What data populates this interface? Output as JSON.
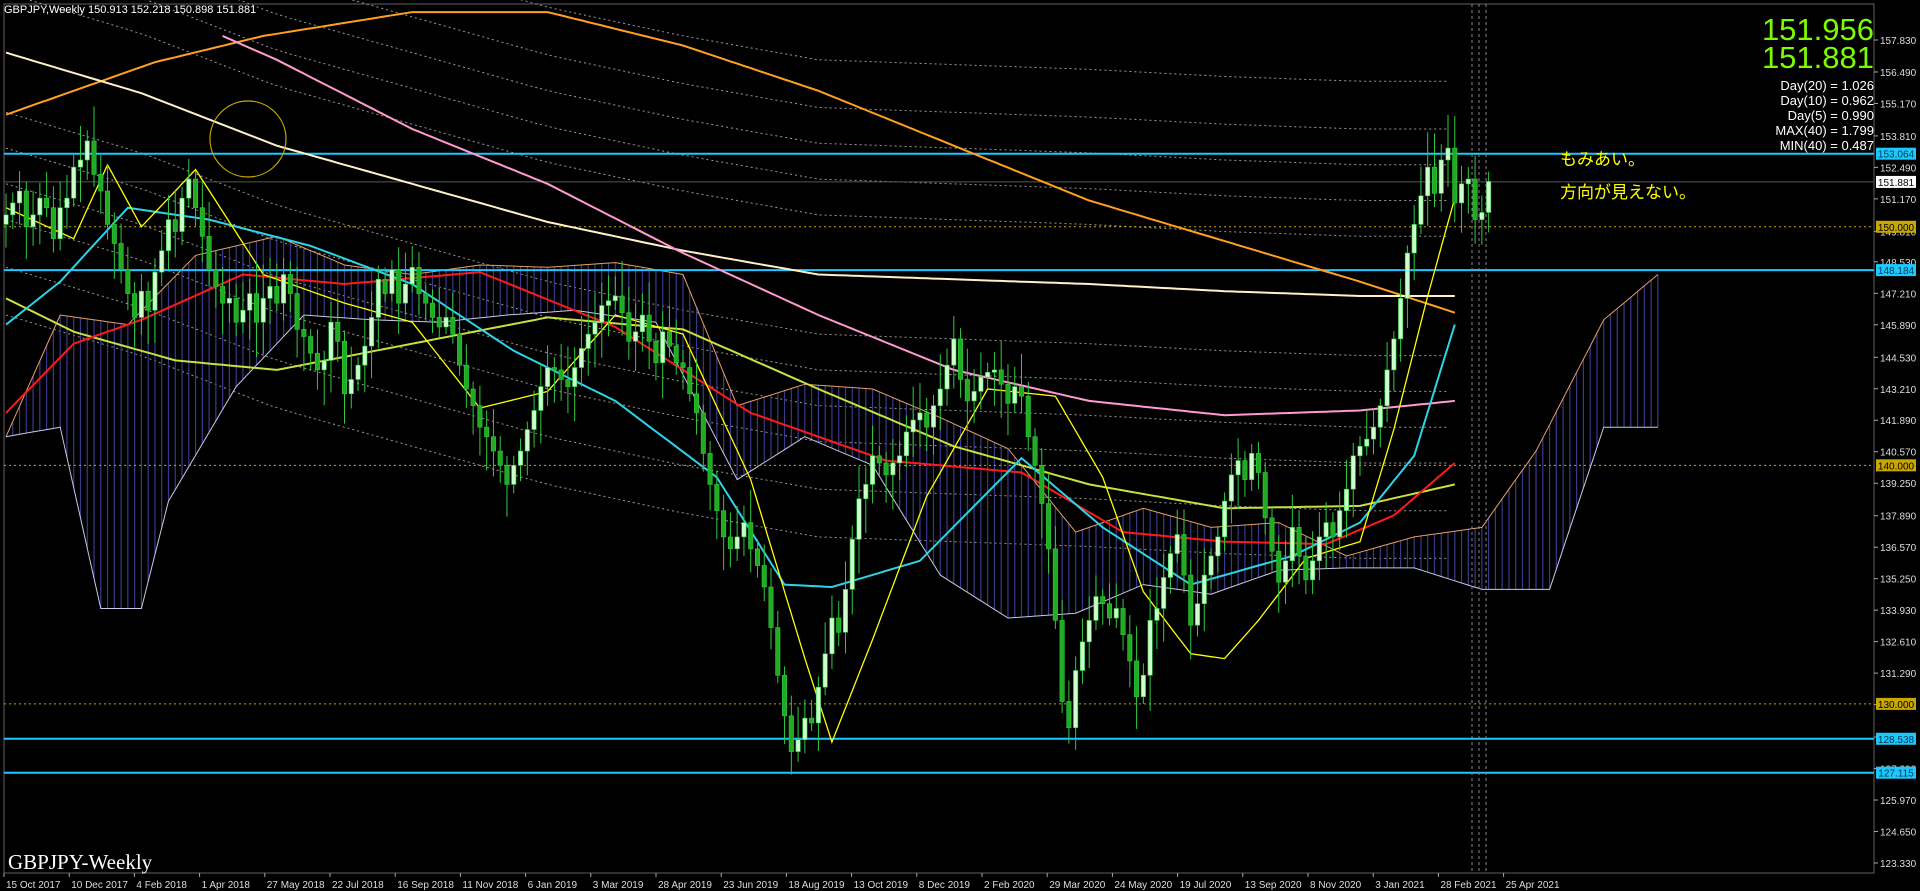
{
  "header": {
    "symbol": "GBPJPY,Weekly",
    "ohlc": "150.913 152.218 150.898 151.881"
  },
  "watermark": "GBPJPY-Weekly",
  "panel": {
    "bid": "151.956",
    "ask": "151.881",
    "stats": [
      "Day(20) = 1.026",
      "Day(10) = 0.962",
      "Day(5) = 0.990",
      "MAX(40) = 1.799",
      "MIN(40) = 0.487"
    ]
  },
  "annotations": [
    "もみあい。",
    "方向が見えない。"
  ],
  "colors": {
    "background": "#000000",
    "bull": "#CCFFCC",
    "bear": "#22AA22",
    "hline": "#1CC8FF",
    "price_label": "#FFFFFF",
    "level_label": "#C8A800",
    "ma_yellow": "#FFFF00",
    "ma_cyan": "#2BD4E8",
    "ma_red": "#FF1A1A",
    "ma_olive": "#C8E040",
    "ma_pink": "#FF9AD0",
    "ma_wheat": "#FFF0C8",
    "ma_orange": "#FFA020"
  },
  "chart_data": {
    "type": "candlestick",
    "ylim": [
      123.33,
      158.03
    ],
    "y_ticks": [
      "157.830",
      "156.490",
      "155.170",
      "153.810",
      "152.490",
      "151.170",
      "149.810",
      "148.530",
      "147.210",
      "145.890",
      "144.530",
      "143.210",
      "141.890",
      "140.570",
      "139.250",
      "137.890",
      "136.570",
      "135.250",
      "133.930",
      "132.610",
      "131.290",
      "129.970",
      "128.610",
      "127.290",
      "125.970",
      "124.650",
      "123.330"
    ],
    "x_labels": [
      "15 Oct 2017",
      "10 Dec 2017",
      "4 Feb 2018",
      "1 Apr 2018",
      "27 May 2018",
      "22 Jul 2018",
      "16 Sep 2018",
      "11 Nov 2018",
      "6 Jan 2019",
      "3 Mar 2019",
      "28 Apr 2019",
      "23 Jun 2019",
      "18 Aug 2019",
      "13 Oct 2019",
      "8 Dec 2019",
      "2 Feb 2020",
      "29 Mar 2020",
      "24 May 2020",
      "19 Jul 2020",
      "13 Sep 2020",
      "8 Nov 2020",
      "3 Jan 2021",
      "28 Feb 2021",
      "25 Apr 2021"
    ],
    "hlines": [
      {
        "value": 153.064,
        "label": "153.064",
        "style": "solid-cyan"
      },
      {
        "value": 148.184,
        "label": "148.184",
        "style": "solid-cyan"
      },
      {
        "value": 128.538,
        "label": "128.538",
        "style": "solid-cyan"
      },
      {
        "value": 127.115,
        "label": "127.115",
        "style": "solid-cyan"
      },
      {
        "value": 150.0,
        "label": "150.000",
        "style": "dotted-gold"
      },
      {
        "value": 140.0,
        "label": "140.000",
        "style": "dotted-gold"
      },
      {
        "value": 130.0,
        "label": "130.000",
        "style": "dotted-gold"
      }
    ],
    "current_price": {
      "value": 151.881,
      "label": "151.881"
    },
    "closes": [
      150.5,
      151.0,
      151.5,
      150.0,
      150.5,
      151.2,
      150.8,
      149.5,
      150.8,
      151.2,
      152.5,
      152.8,
      153.6,
      152.2,
      151.5,
      150.1,
      149.3,
      148.2,
      147.2,
      146.2,
      147.3,
      146.5,
      148.1,
      149.0,
      150.3,
      149.8,
      151.2,
      152.0,
      150.8,
      149.6,
      148.2,
      147.5,
      146.8,
      147.0,
      146.0,
      146.5,
      147.2,
      146.0,
      147.0,
      147.5,
      146.8,
      148.0,
      147.2,
      145.7,
      145.4,
      144.7,
      144.0,
      144.4,
      146.0,
      145.2,
      143.0,
      143.6,
      144.2,
      145.0,
      146.2,
      147.8,
      147.2,
      148.2,
      146.8,
      147.6,
      148.3,
      147.2,
      146.8,
      146.2,
      145.8,
      146.2,
      145.5,
      144.2,
      143.2,
      142.5,
      141.6,
      141.2,
      140.6,
      140.0,
      139.2,
      140.0,
      140.6,
      141.5,
      142.3,
      143.3,
      144.1,
      144.0,
      143.6,
      143.3,
      144.1,
      144.9,
      145.5,
      146.0,
      146.7,
      146.9,
      147.1,
      146.4,
      145.2,
      145.6,
      146.3,
      145.2,
      144.3,
      145.6,
      145.0,
      144.3,
      144.1,
      143.0,
      142.2,
      140.5,
      139.2,
      138.1,
      137.0,
      136.5,
      137.0,
      137.6,
      136.5,
      135.8,
      134.9,
      133.2,
      131.2,
      129.5,
      128.0,
      128.5,
      129.4,
      129.2,
      130.7,
      132.1,
      133.6,
      133.0,
      134.8,
      136.9,
      138.6,
      139.2,
      140.4,
      140.1,
      139.6,
      140.1,
      140.4,
      141.4,
      141.9,
      142.2,
      141.6,
      142.5,
      143.2,
      144.2,
      145.3,
      143.6,
      142.7,
      143.1,
      143.7,
      143.9,
      144.0,
      143.4,
      142.6,
      143.3,
      142.9,
      141.2,
      140.0,
      138.4,
      136.5,
      133.5,
      130.1,
      129.0,
      131.4,
      132.6,
      133.5,
      134.5,
      134.2,
      133.6,
      134.0,
      132.9,
      131.8,
      130.3,
      131.2,
      133.5,
      134.0,
      135.3,
      136.3,
      137.1,
      135.4,
      133.3,
      134.2,
      135.4,
      136.2,
      137.0,
      138.5,
      139.6,
      140.2,
      139.4,
      140.5,
      139.7,
      137.8,
      136.4,
      135.1,
      136.0,
      137.4,
      136.2,
      135.2,
      136.0,
      137.0,
      137.6,
      137.0,
      138.1,
      139.0,
      140.4,
      140.8,
      141.1,
      141.6,
      142.5,
      144.0,
      145.3,
      147.0,
      148.9,
      150.1,
      151.3,
      152.5,
      151.4,
      152.8,
      153.3,
      151.0,
      151.8,
      152.0,
      150.3,
      150.6,
      151.9
    ],
    "moving_averages": [
      {
        "key": "ma_orange",
        "values": [
          [
            0,
            154.7
          ],
          [
            10,
            155.7
          ],
          [
            22,
            156.9
          ],
          [
            38,
            158.0
          ],
          [
            60,
            159.0
          ],
          [
            80,
            159.0
          ],
          [
            100,
            157.6
          ],
          [
            120,
            155.7
          ],
          [
            140,
            153.4
          ],
          [
            160,
            151.1
          ],
          [
            180,
            149.4
          ],
          [
            200,
            147.7
          ],
          [
            214,
            146.4
          ]
        ]
      },
      {
        "key": "ma_wheat",
        "values": [
          [
            0,
            157.3
          ],
          [
            20,
            155.6
          ],
          [
            40,
            153.4
          ],
          [
            60,
            151.8
          ],
          [
            80,
            150.2
          ],
          [
            100,
            149.0
          ],
          [
            120,
            148.0
          ],
          [
            140,
            147.8
          ],
          [
            160,
            147.6
          ],
          [
            180,
            147.3
          ],
          [
            200,
            147.1
          ],
          [
            214,
            147.1
          ]
        ]
      },
      {
        "key": "ma_pink",
        "values": [
          [
            32,
            158.0
          ],
          [
            40,
            157.0
          ],
          [
            60,
            154.1
          ],
          [
            80,
            151.8
          ],
          [
            100,
            148.9
          ],
          [
            120,
            146.3
          ],
          [
            140,
            144.0
          ],
          [
            160,
            142.7
          ],
          [
            180,
            142.1
          ],
          [
            200,
            142.3
          ],
          [
            214,
            142.7
          ]
        ]
      },
      {
        "key": "ma_olive",
        "values": [
          [
            0,
            147.0
          ],
          [
            10,
            145.6
          ],
          [
            25,
            144.4
          ],
          [
            40,
            144.0
          ],
          [
            60,
            145.1
          ],
          [
            80,
            146.2
          ],
          [
            100,
            145.7
          ],
          [
            120,
            143.2
          ],
          [
            140,
            140.8
          ],
          [
            160,
            139.2
          ],
          [
            180,
            138.2
          ],
          [
            200,
            138.3
          ],
          [
            214,
            139.2
          ]
        ]
      },
      {
        "key": "ma_red",
        "values": [
          [
            0,
            142.2
          ],
          [
            10,
            145.1
          ],
          [
            20,
            146.1
          ],
          [
            35,
            148.0
          ],
          [
            50,
            147.6
          ],
          [
            70,
            148.1
          ],
          [
            90,
            145.8
          ],
          [
            110,
            142.2
          ],
          [
            130,
            140.2
          ],
          [
            150,
            139.7
          ],
          [
            165,
            137.2
          ],
          [
            180,
            136.8
          ],
          [
            195,
            136.7
          ],
          [
            205,
            137.9
          ],
          [
            214,
            140.1
          ]
        ]
      },
      {
        "key": "ma_cyan",
        "values": [
          [
            0,
            145.9
          ],
          [
            8,
            147.7
          ],
          [
            18,
            150.8
          ],
          [
            30,
            150.3
          ],
          [
            45,
            149.2
          ],
          [
            60,
            147.6
          ],
          [
            75,
            144.8
          ],
          [
            90,
            142.7
          ],
          [
            105,
            139.5
          ],
          [
            115,
            135.0
          ],
          [
            122,
            134.9
          ],
          [
            135,
            136.0
          ],
          [
            150,
            140.3
          ],
          [
            162,
            137.4
          ],
          [
            175,
            135.0
          ],
          [
            190,
            136.2
          ],
          [
            200,
            137.6
          ],
          [
            208,
            140.4
          ],
          [
            214,
            145.9
          ]
        ]
      },
      {
        "key": "ma_yellow",
        "values": [
          [
            0,
            150.8
          ],
          [
            10,
            149.5
          ],
          [
            15,
            152.6
          ],
          [
            20,
            150.0
          ],
          [
            28,
            152.4
          ],
          [
            38,
            148.0
          ],
          [
            50,
            146.8
          ],
          [
            60,
            146.0
          ],
          [
            70,
            142.4
          ],
          [
            80,
            143.1
          ],
          [
            90,
            146.3
          ],
          [
            100,
            145.5
          ],
          [
            110,
            139.4
          ],
          [
            118,
            131.9
          ],
          [
            122,
            128.4
          ],
          [
            128,
            132.7
          ],
          [
            136,
            138.7
          ],
          [
            145,
            143.2
          ],
          [
            155,
            142.9
          ],
          [
            162,
            139.5
          ],
          [
            168,
            134.7
          ],
          [
            175,
            132.1
          ],
          [
            180,
            131.9
          ],
          [
            185,
            133.5
          ],
          [
            192,
            136.1
          ],
          [
            200,
            136.8
          ],
          [
            205,
            141.5
          ],
          [
            210,
            147.1
          ],
          [
            214,
            151.2
          ]
        ]
      }
    ],
    "ichimoku_cloud": {
      "upper": [
        [
          0,
          141.2
        ],
        [
          8,
          146.3
        ],
        [
          18,
          145.9
        ],
        [
          28,
          148.8
        ],
        [
          40,
          149.6
        ],
        [
          50,
          148.4
        ],
        [
          60,
          148.0
        ],
        [
          70,
          148.4
        ],
        [
          80,
          148.3
        ],
        [
          90,
          148.5
        ],
        [
          100,
          148.0
        ],
        [
          108,
          142.5
        ],
        [
          118,
          143.4
        ],
        [
          128,
          143.2
        ],
        [
          138,
          142.0
        ],
        [
          148,
          140.7
        ],
        [
          158,
          137.2
        ],
        [
          168,
          138.2
        ],
        [
          178,
          137.4
        ],
        [
          188,
          137.6
        ],
        [
          198,
          136.2
        ],
        [
          208,
          137.0
        ],
        [
          218,
          137.4
        ],
        [
          226,
          140.6
        ],
        [
          236,
          146.1
        ],
        [
          244,
          148.0
        ]
      ],
      "lower": [
        [
          0,
          141.2
        ],
        [
          8,
          141.6
        ],
        [
          14,
          134.0
        ],
        [
          20,
          134.0
        ],
        [
          24,
          138.5
        ],
        [
          34,
          143.3
        ],
        [
          44,
          146.3
        ],
        [
          54,
          146.1
        ],
        [
          64,
          146.0
        ],
        [
          74,
          146.3
        ],
        [
          84,
          146.5
        ],
        [
          96,
          146.0
        ],
        [
          108,
          139.4
        ],
        [
          118,
          141.2
        ],
        [
          128,
          140.0
        ],
        [
          138,
          135.4
        ],
        [
          148,
          133.6
        ],
        [
          158,
          133.8
        ],
        [
          168,
          135.0
        ],
        [
          178,
          134.6
        ],
        [
          188,
          135.6
        ],
        [
          198,
          135.7
        ],
        [
          208,
          135.7
        ],
        [
          218,
          134.8
        ],
        [
          228,
          134.8
        ],
        [
          236,
          141.6
        ],
        [
          244,
          141.6
        ]
      ]
    }
  }
}
